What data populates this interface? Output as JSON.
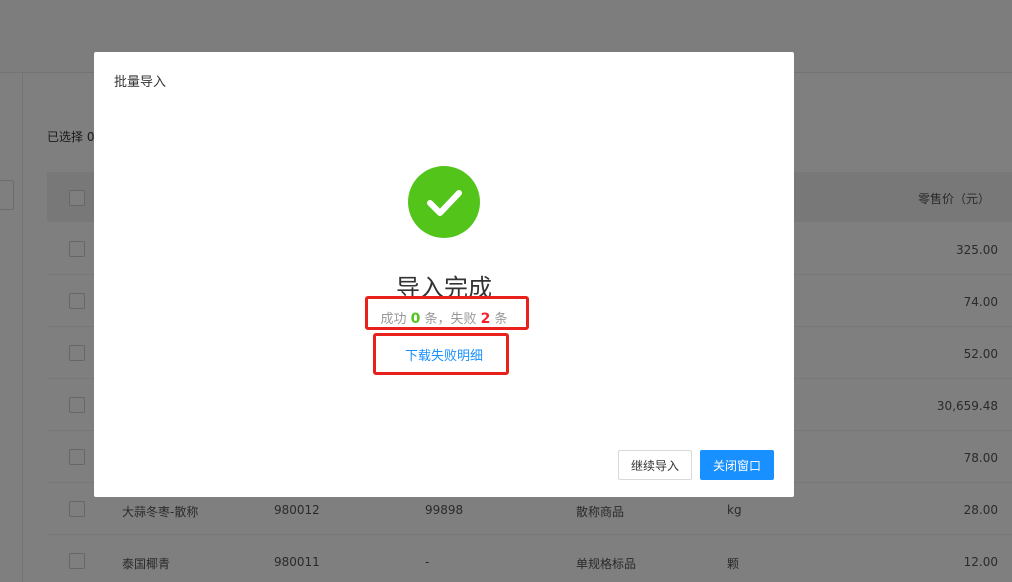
{
  "background": {
    "selected_label": "已选择 0",
    "price_header": "零售价（元）",
    "rows": [
      {
        "name": "",
        "code": "",
        "barcode": "",
        "type": "",
        "unit": "",
        "price": "325.00"
      },
      {
        "name": "",
        "code": "",
        "barcode": "",
        "type": "",
        "unit": "",
        "price": "74.00"
      },
      {
        "name": "",
        "code": "",
        "barcode": "",
        "type": "",
        "unit": "",
        "price": "52.00"
      },
      {
        "name": "",
        "code": "",
        "barcode": "",
        "type": "",
        "unit": "",
        "price": "30,659.48"
      },
      {
        "name": "",
        "code": "",
        "barcode": "",
        "type": "",
        "unit": "",
        "price": "78.00"
      },
      {
        "name": "大蒜冬枣-散称",
        "code": "980012",
        "barcode": "99898",
        "type": "散称商品",
        "unit": "kg",
        "price": "28.00"
      },
      {
        "name": "泰国椰青",
        "code": "980011",
        "barcode": "-",
        "type": "单规格标品",
        "unit": "颗",
        "price": "12.00"
      }
    ]
  },
  "modal": {
    "title": "批量导入",
    "result_title": "导入完成",
    "summary": {
      "prefix": "成功 ",
      "success_count": "0",
      "middle": " 条，失败 ",
      "fail_count": "2",
      "suffix": " 条"
    },
    "download_link": "下载失败明细",
    "buttons": {
      "continue": "继续导入",
      "close": "关闭窗口"
    }
  },
  "colors": {
    "success": "#52c41a",
    "fail": "#f5222d",
    "primary": "#1890ff",
    "annotation": "#e8211c"
  },
  "icons": {
    "result": "check-circle-icon"
  }
}
